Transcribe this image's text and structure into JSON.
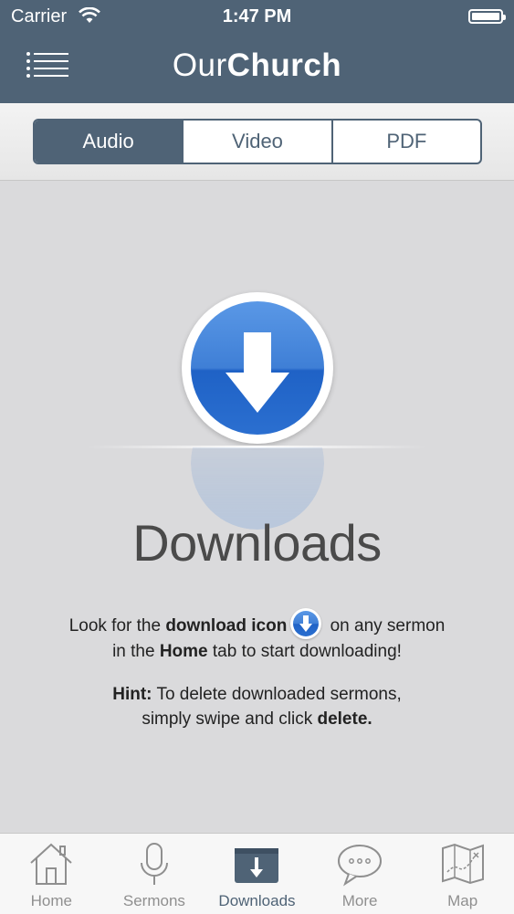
{
  "status_bar": {
    "carrier": "Carrier",
    "time": "1:47 PM"
  },
  "header": {
    "title_light": "Our",
    "title_bold": "Church"
  },
  "segments": [
    {
      "label": "Audio",
      "active": true
    },
    {
      "label": "Video",
      "active": false
    },
    {
      "label": "PDF",
      "active": false
    }
  ],
  "main": {
    "title": "Downloads",
    "line1_a": "Look for the ",
    "line1_b": "download icon",
    "line1_c": " on any sermon",
    "line2_a": "in the ",
    "line2_b": "Home",
    "line2_c": " tab to start downloading!",
    "hint_label": "Hint:",
    "hint_a": " To delete downloaded sermons,",
    "hint_b": "simply swipe and click ",
    "hint_c": "delete."
  },
  "tabs": [
    {
      "label": "Home",
      "icon": "house-icon",
      "active": false
    },
    {
      "label": "Sermons",
      "icon": "microphone-icon",
      "active": false
    },
    {
      "label": "Downloads",
      "icon": "download-box-icon",
      "active": true
    },
    {
      "label": "More",
      "icon": "speech-bubble-icon",
      "active": false
    },
    {
      "label": "Map",
      "icon": "map-icon",
      "active": false
    }
  ],
  "colors": {
    "header": "#4f6376",
    "accent_blue": "#2b6fd0",
    "background": "#dadadc"
  }
}
